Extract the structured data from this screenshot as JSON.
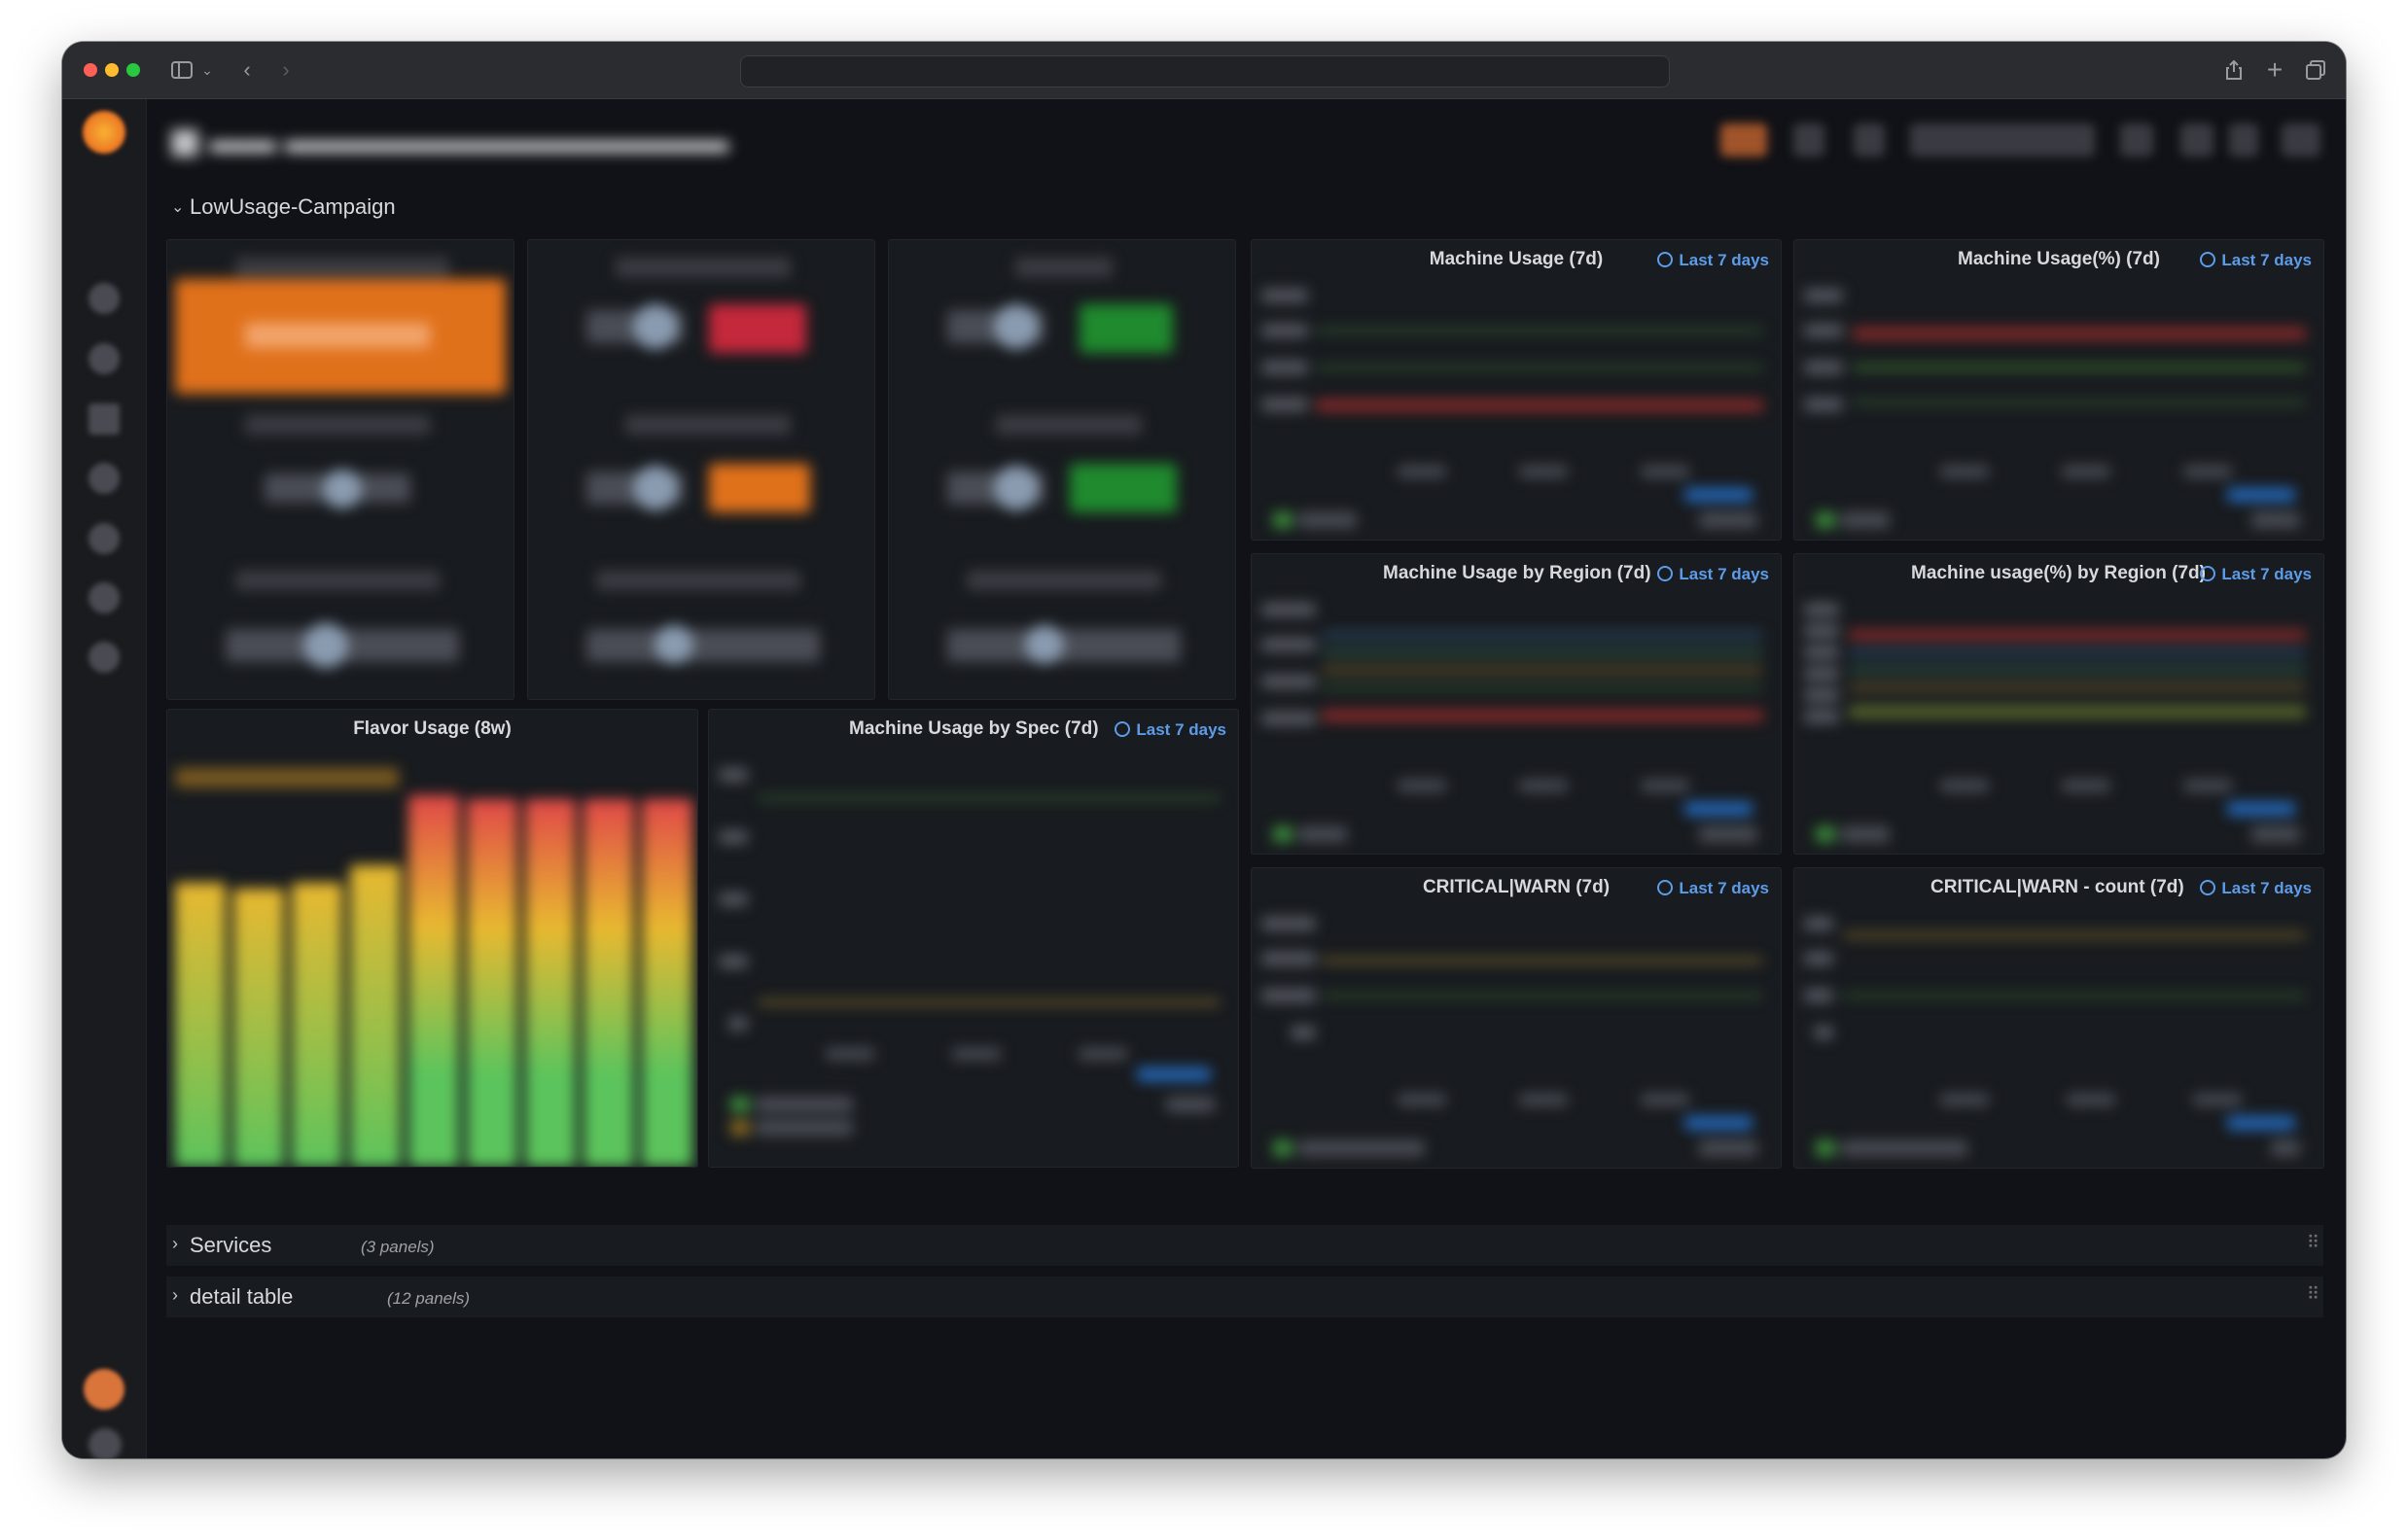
{
  "dashboard": {
    "row_expanded": {
      "title": "LowUsage-Campaign"
    },
    "rows_collapsed": [
      {
        "title": "Services",
        "count": "(3 panels)"
      },
      {
        "title": "detail table",
        "count": "(12 panels)"
      }
    ]
  },
  "panels": {
    "machine_usage": {
      "title": "Machine Usage (7d)",
      "time": "Last 7 days"
    },
    "machine_usage_pct": {
      "title": "Machine Usage(%) (7d)",
      "time": "Last 7 days"
    },
    "machine_usage_region": {
      "title": "Machine Usage by Region (7d)",
      "time": "Last 7 days"
    },
    "machine_usage_pct_region": {
      "title": "Machine usage(%) by Region (7d)",
      "time": "Last 7 days"
    },
    "critical_warn": {
      "title": "CRITICAL|WARN (7d)",
      "time": "Last 7 days"
    },
    "critical_warn_count": {
      "title": "CRITICAL|WARN - count (7d)",
      "time": "Last 7 days"
    },
    "flavor_usage": {
      "title": "Flavor Usage (8w)"
    },
    "machine_usage_spec": {
      "title": "Machine Usage by Spec (7d)",
      "time": "Last 7 days"
    }
  },
  "colors": {
    "accent": "#5d9ce8",
    "background": "#111217",
    "panel": "#181b1f",
    "stat_orange": "#e0711b",
    "stat_red": "#c4283b",
    "stat_green": "#1f8a2e"
  }
}
